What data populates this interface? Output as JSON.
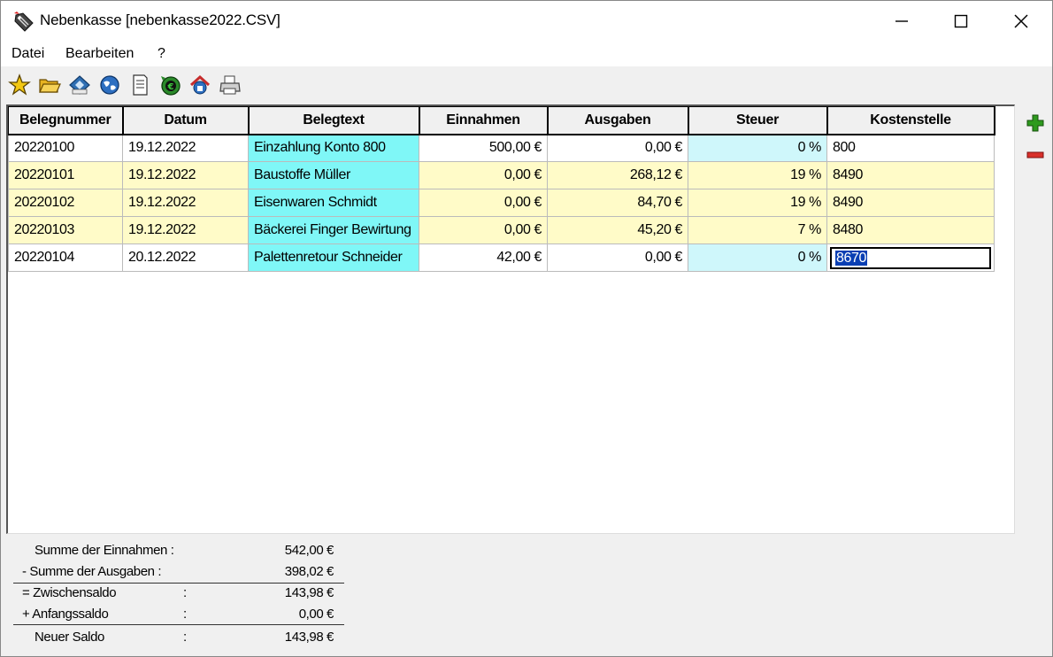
{
  "window": {
    "title": "Nebenkasse [nebenkasse2022.CSV]",
    "controls": {
      "minimize": "─",
      "maximize": "☐",
      "close": "✕"
    }
  },
  "menu": {
    "items": [
      {
        "label": "Datei"
      },
      {
        "label": "Bearbeiten"
      },
      {
        "label": "?"
      }
    ]
  },
  "toolbar": {
    "icons": [
      "star-icon",
      "folder-icon",
      "save-disk-icon",
      "globe-icon",
      "document-icon",
      "money-icon",
      "home-icon",
      "printer-icon"
    ]
  },
  "grid": {
    "columns": [
      "Belegnummer",
      "Datum",
      "Belegtext",
      "Einnahmen",
      "Ausgaben",
      "Steuer",
      "Kostenstelle"
    ],
    "rows": [
      {
        "belegnummer": "20220100",
        "datum": "19.12.2022",
        "belegtext": "Einzahlung Konto 800",
        "einnahmen": "500,00 €",
        "ausgaben": "0,00 €",
        "steuer": "0 %",
        "kostenstelle": "800"
      },
      {
        "belegnummer": "20220101",
        "datum": "19.12.2022",
        "belegtext": "Baustoffe Müller",
        "einnahmen": "0,00 €",
        "ausgaben": "268,12 €",
        "steuer": "19 %",
        "kostenstelle": "8490"
      },
      {
        "belegnummer": "20220102",
        "datum": "19.12.2022",
        "belegtext": "Eisenwaren Schmidt",
        "einnahmen": "0,00 €",
        "ausgaben": "84,70 €",
        "steuer": "19 %",
        "kostenstelle": "8490"
      },
      {
        "belegnummer": "20220103",
        "datum": "19.12.2022",
        "belegtext": "Bäckerei Finger Bewirtung",
        "einnahmen": "0,00 €",
        "ausgaben": "45,20 €",
        "steuer": "7 %",
        "kostenstelle": "8480"
      },
      {
        "belegnummer": "20220104",
        "datum": "20.12.2022",
        "belegtext": "Palettenretour Schneider",
        "einnahmen": "42,00 €",
        "ausgaben": "0,00 €",
        "steuer": "0 %",
        "kostenstelle": "8670"
      }
    ],
    "add_icon": "plus-icon",
    "remove_icon": "minus-icon"
  },
  "summary": {
    "einnahmen_label": "Summe der Einnahmen :",
    "einnahmen_value": "542,00 €",
    "ausgaben_label": "-  Summe der Ausgaben  :",
    "ausgaben_value": "398,02 €",
    "zwischensaldo_label": "= Zwischensaldo",
    "zwischensaldo_value": "143,98 €",
    "anfangssaldo_label": "+ Anfangssaldo",
    "anfangssaldo_value": "0,00 €",
    "neuer_saldo_label": "Neuer Saldo",
    "neuer_saldo_value": "143,98 €",
    "colon": ":"
  },
  "colors": {
    "cyan_cell": "#7ff7f7",
    "light_cyan_tax": "#cff7fb",
    "yellow_row": "#fffbc8",
    "selection": "#0a3fb3",
    "plus_green": "#2e9a1e",
    "minus_red": "#d9302a"
  }
}
